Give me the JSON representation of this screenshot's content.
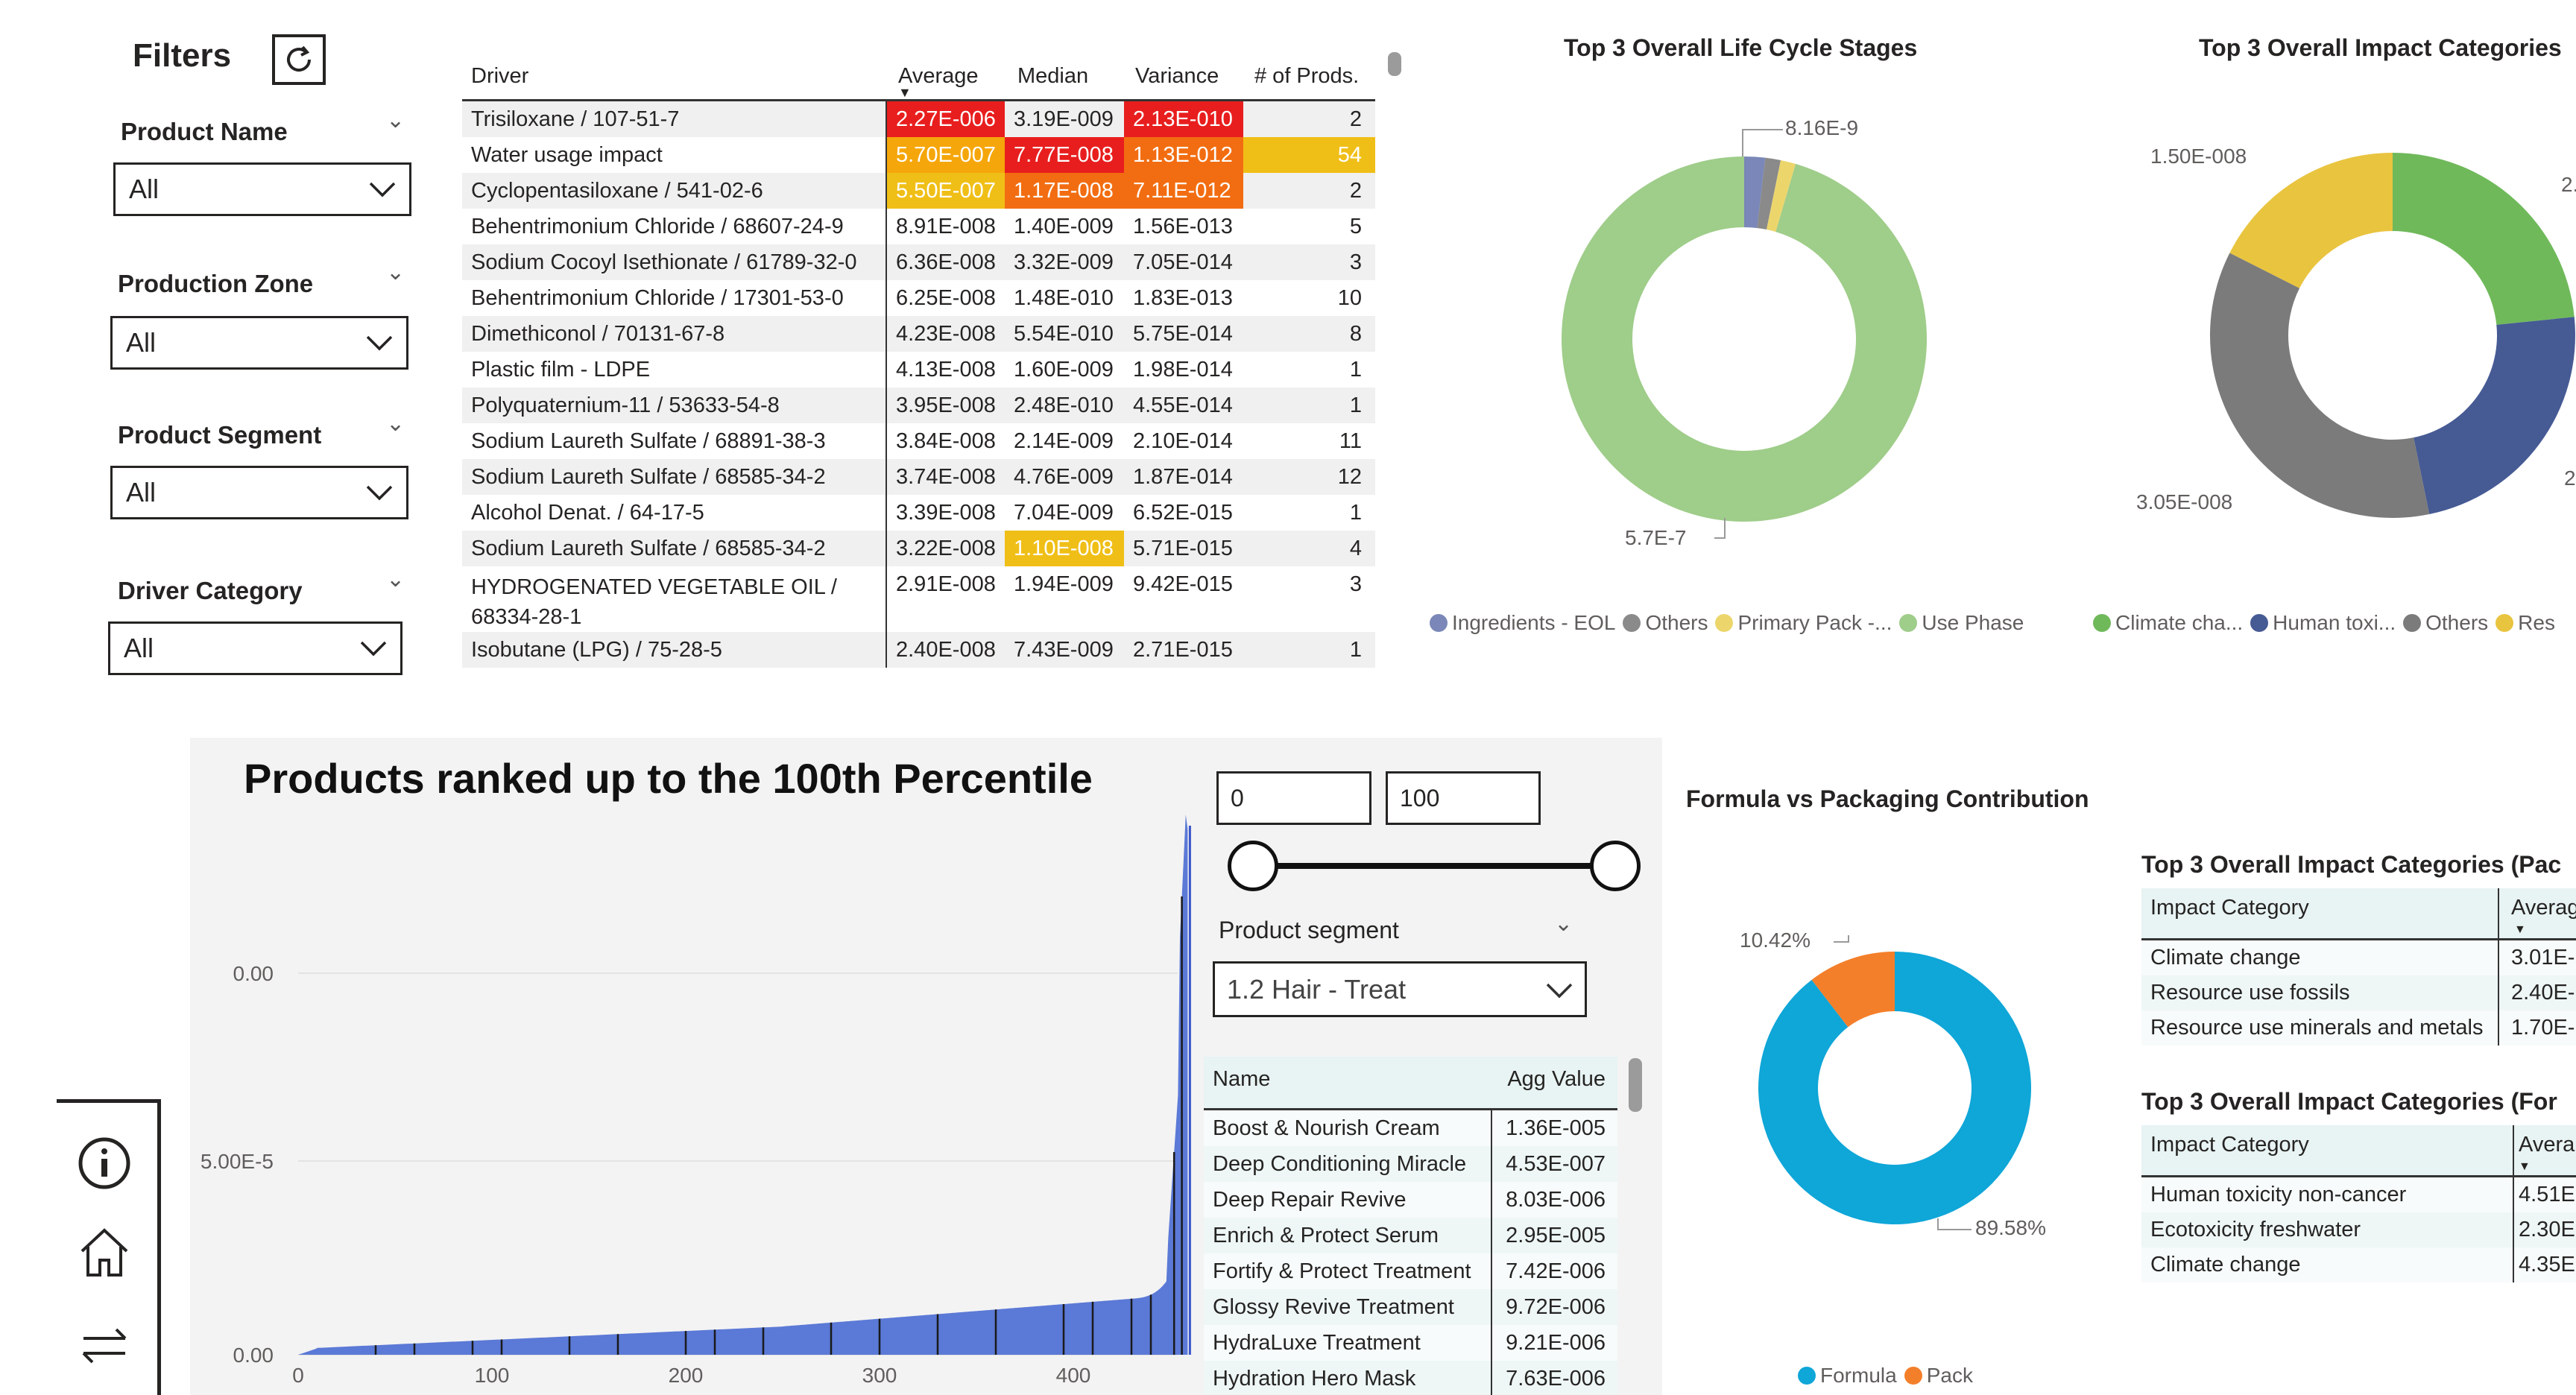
{
  "filters": {
    "title": "Filters",
    "items": [
      {
        "label": "Product Name",
        "value": "All"
      },
      {
        "label": "Production Zone",
        "value": "All"
      },
      {
        "label": "Product Segment",
        "value": "All"
      },
      {
        "label": "Driver Category",
        "value": "All"
      }
    ]
  },
  "drivers_table": {
    "headers": {
      "driver": "Driver",
      "average": "Average",
      "median": "Median",
      "variance": "Variance",
      "count": "# of Prods."
    },
    "rows": [
      {
        "driver": "Trisiloxane / 107-51-7",
        "average": "2.27E-006",
        "median": "3.19E-009",
        "variance": "2.13E-010",
        "count": "2"
      },
      {
        "driver": "Water usage impact",
        "average": "5.70E-007",
        "median": "7.77E-008",
        "variance": "1.13E-012",
        "count": "54"
      },
      {
        "driver": "Cyclopentasiloxane / 541-02-6",
        "average": "5.50E-007",
        "median": "1.17E-008",
        "variance": "7.11E-012",
        "count": "2"
      },
      {
        "driver": "Behentrimonium Chloride / 68607-24-9",
        "average": "8.91E-008",
        "median": "1.40E-009",
        "variance": "1.56E-013",
        "count": "5"
      },
      {
        "driver": "Sodium Cocoyl Isethionate / 61789-32-0",
        "average": "6.36E-008",
        "median": "3.32E-009",
        "variance": "7.05E-014",
        "count": "3"
      },
      {
        "driver": "Behentrimonium Chloride / 17301-53-0",
        "average": "6.25E-008",
        "median": "1.48E-010",
        "variance": "1.83E-013",
        "count": "10"
      },
      {
        "driver": "Dimethiconol / 70131-67-8",
        "average": "4.23E-008",
        "median": "5.54E-010",
        "variance": "5.75E-014",
        "count": "8"
      },
      {
        "driver": "Plastic film - LDPE",
        "average": "4.13E-008",
        "median": "1.60E-009",
        "variance": "1.98E-014",
        "count": "1"
      },
      {
        "driver": "Polyquaternium-11 / 53633-54-8",
        "average": "3.95E-008",
        "median": "2.48E-010",
        "variance": "4.55E-014",
        "count": "1"
      },
      {
        "driver": "Sodium Laureth Sulfate / 68891-38-3",
        "average": "3.84E-008",
        "median": "2.14E-009",
        "variance": "2.10E-014",
        "count": "11"
      },
      {
        "driver": "Sodium Laureth Sulfate / 68585-34-2",
        "average": "3.74E-008",
        "median": "4.76E-009",
        "variance": "1.87E-014",
        "count": "12"
      },
      {
        "driver": "Alcohol Denat. / 64-17-5",
        "average": "3.39E-008",
        "median": "7.04E-009",
        "variance": "6.52E-015",
        "count": "1"
      },
      {
        "driver": "Sodium Laureth Sulfate / 68585-34-2",
        "average": "3.22E-008",
        "median": "1.10E-008",
        "variance": "5.71E-015",
        "count": "4"
      },
      {
        "driver": "HYDROGENATED VEGETABLE OIL / 68334-28-1",
        "average": "2.91E-008",
        "median": "1.94E-009",
        "variance": "9.42E-015",
        "count": "3"
      },
      {
        "driver": "Isobutane (LPG) / 75-28-5",
        "average": "2.40E-008",
        "median": "7.43E-009",
        "variance": "2.71E-015",
        "count": "1"
      }
    ]
  },
  "life_cycle_chart": {
    "title": "Top 3 Overall Life Cycle Stages",
    "labels": {
      "small": "8.16E-9",
      "large": "5.7E-7"
    },
    "legend": [
      "Ingredients - EOL",
      "Others",
      "Primary Pack -...",
      "Use Phase"
    ],
    "colors": [
      "#7a87b8",
      "#8a8a8a",
      "#ecd66c",
      "#9fcd8a"
    ]
  },
  "impact_chart": {
    "title": "Top 3 Overall Impact Categories",
    "labels": {
      "top_left": "1.50E-008",
      "bottom_left": "3.05E-008",
      "top_right": "2.",
      "bottom_right": "2"
    },
    "legend": [
      "Climate cha...",
      "Human toxi...",
      "Others",
      "Res"
    ],
    "colors": [
      "#6fb95a",
      "#465a94",
      "#7b7b7b",
      "#e9c43f"
    ]
  },
  "percentile_panel": {
    "title": "Products ranked up to the 100th Percentile",
    "range_min": "0",
    "range_max": "100",
    "segment_label": "Product segment",
    "segment_value": "1.2 Hair - Treat",
    "y_ticks": [
      "0.00",
      "5.00E-5",
      "0.00"
    ],
    "x_ticks": [
      "0",
      "100",
      "200",
      "300",
      "400"
    ]
  },
  "agg_table": {
    "headers": {
      "name": "Name",
      "value": "Agg Value"
    },
    "rows": [
      {
        "name": "Boost & Nourish Cream",
        "value": "1.36E-005"
      },
      {
        "name": "Deep Conditioning Miracle",
        "value": "4.53E-007"
      },
      {
        "name": "Deep Repair Revive",
        "value": "8.03E-006"
      },
      {
        "name": "Enrich & Protect Serum",
        "value": "2.95E-005"
      },
      {
        "name": "Fortify & Protect Treatment",
        "value": "7.42E-006"
      },
      {
        "name": "Glossy Revive Treatment",
        "value": "9.72E-006"
      },
      {
        "name": "HydraLuxe Treatment",
        "value": "9.21E-006"
      },
      {
        "name": "Hydration Hero Mask",
        "value": "7.63E-006"
      }
    ]
  },
  "formula_chart": {
    "title": "Formula vs Packaging Contribution",
    "label_small": "10.42%",
    "label_large": "89.58%",
    "legend": [
      "Formula",
      "Pack"
    ],
    "colors": [
      "#0fa6d8",
      "#f47f2a"
    ],
    "chart_data": {
      "type": "pie",
      "categories": [
        "Formula",
        "Pack"
      ],
      "values": [
        89.58,
        10.42
      ]
    }
  },
  "pack_table": {
    "title": "Top 3 Overall Impact Categories (Pac",
    "headers": {
      "category": "Impact Category",
      "average": "Averag"
    },
    "rows": [
      {
        "category": "Climate change",
        "average": "3.01E-"
      },
      {
        "category": "Resource use fossils",
        "average": "2.40E-"
      },
      {
        "category": "Resource use minerals and metals",
        "average": "1.70E-"
      }
    ]
  },
  "formula_table": {
    "title": "Top 3 Overall Impact Categories (For",
    "headers": {
      "category": "Impact Category",
      "average": "Avera"
    },
    "rows": [
      {
        "category": "Human toxicity non-cancer",
        "average": "4.51E-"
      },
      {
        "category": "Ecotoxicity freshwater",
        "average": "2.30E-"
      },
      {
        "category": "Climate change",
        "average": "4.35E-"
      }
    ]
  },
  "chart_data": [
    {
      "type": "pie",
      "title": "Top 3 Overall Life Cycle Stages",
      "categories": [
        "Ingredients - EOL",
        "Others",
        "Primary Pack -...",
        "Use Phase"
      ],
      "values": [
        1.1e-08,
        8.16e-09,
        8e-09,
        5.7e-07
      ]
    },
    {
      "type": "pie",
      "title": "Top 3 Overall Impact Categories",
      "categories": [
        "Climate cha...",
        "Human toxi...",
        "Others",
        "Res"
      ],
      "values": [
        2e-08,
        2e-08,
        3.05e-08,
        1.5e-08
      ]
    },
    {
      "type": "pie",
      "title": "Formula vs Packaging Contribution",
      "categories": [
        "Formula",
        "Pack"
      ],
      "values": [
        89.58,
        10.42
      ]
    }
  ]
}
